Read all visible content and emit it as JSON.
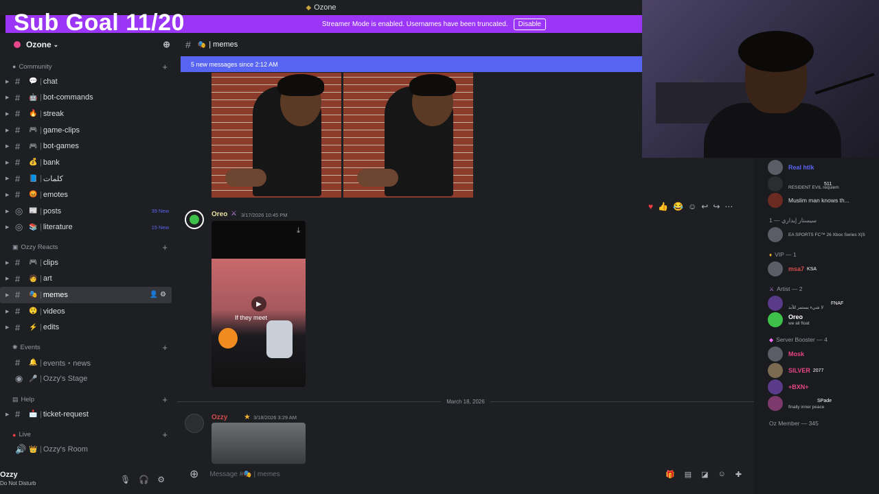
{
  "titlebar": {
    "title": "Ozone"
  },
  "overlay": {
    "sub_goal": "Sub Goal 11/20"
  },
  "streamer_bar": {
    "message": "Streamer Mode is enabled. Usernames have been truncated.",
    "disable_label": "Disable"
  },
  "server": {
    "name": "Ozone"
  },
  "sidebar": {
    "categories": {
      "community": "Community",
      "ozzy_reacts": "Ozzy Reacts",
      "events": "Events",
      "help": "Help",
      "live": "Live"
    },
    "channels": {
      "chat": "chat",
      "bot_commands": "bot-commands",
      "streak": "streak",
      "game_clips": "game-clips",
      "bot_games": "bot-games",
      "bank": "bank",
      "arabic": "كلمات",
      "emotes": "emotes",
      "posts": "posts",
      "posts_new": "39 New",
      "literature": "literature",
      "literature_new": "15 New",
      "clips": "clips",
      "art": "art",
      "memes": "memes",
      "videos": "videos",
      "edits": "edits",
      "events_news": "events・news",
      "ozzys_stage": "Ozzy's Stage",
      "ticket_request": "ticket-request",
      "ozzys_room": "Ozzy's Room"
    }
  },
  "user_panel": {
    "name": "Ozzy",
    "status": "Do Not Disturb"
  },
  "chat": {
    "channel_name": "memes",
    "new_messages_banner": "5 new messages since 2:12 AM",
    "message1": {
      "author": "Oreo",
      "timestamp": "3/17/2026 10:45 PM"
    },
    "video_caption": "If they meet",
    "day_divider": "March 18, 2026",
    "message2": {
      "author": "Ozzy",
      "timestamp": "3/18/2026 3:29 AM"
    },
    "composer_placeholder": "Message #🎭 | memes"
  },
  "members": {
    "top": [
      {
        "name": "Real htlk",
        "color": "#5865f2"
      },
      {
        "name": "",
        "tag": "511",
        "sub": "RESIDENT EVIL requiem"
      },
      {
        "name": "",
        "sub": "Muslim man knows th..."
      }
    ],
    "group_arabic": "سيستار إيداري — 1",
    "arabic_member_sub": "EA SPORTS FC™ 26 Xbox Series X|S",
    "group_vip": "VIP — 1",
    "vip_member": {
      "name": "msa7",
      "tag": "KSA",
      "color": "#d24c4c"
    },
    "group_artist": "Artist — 2",
    "artist_1": {
      "tag": "FNAF",
      "sub": "لا شيء يستمر للأبد"
    },
    "artist_2": {
      "name": "Oreo",
      "sub": "we all float",
      "color": "#ffffff"
    },
    "group_booster": "Server Booster — 4",
    "booster_1": {
      "name": "Mosk",
      "color": "#e8478b"
    },
    "booster_2": {
      "name": "SILVER",
      "tag": "2077",
      "color": "#e8478b"
    },
    "booster_3": {
      "name": "+BXN+",
      "color": "#e8478b"
    },
    "booster_4": {
      "tag": "SPade",
      "sub": "finally inner peace"
    },
    "group_member": "Oz Member — 345"
  }
}
